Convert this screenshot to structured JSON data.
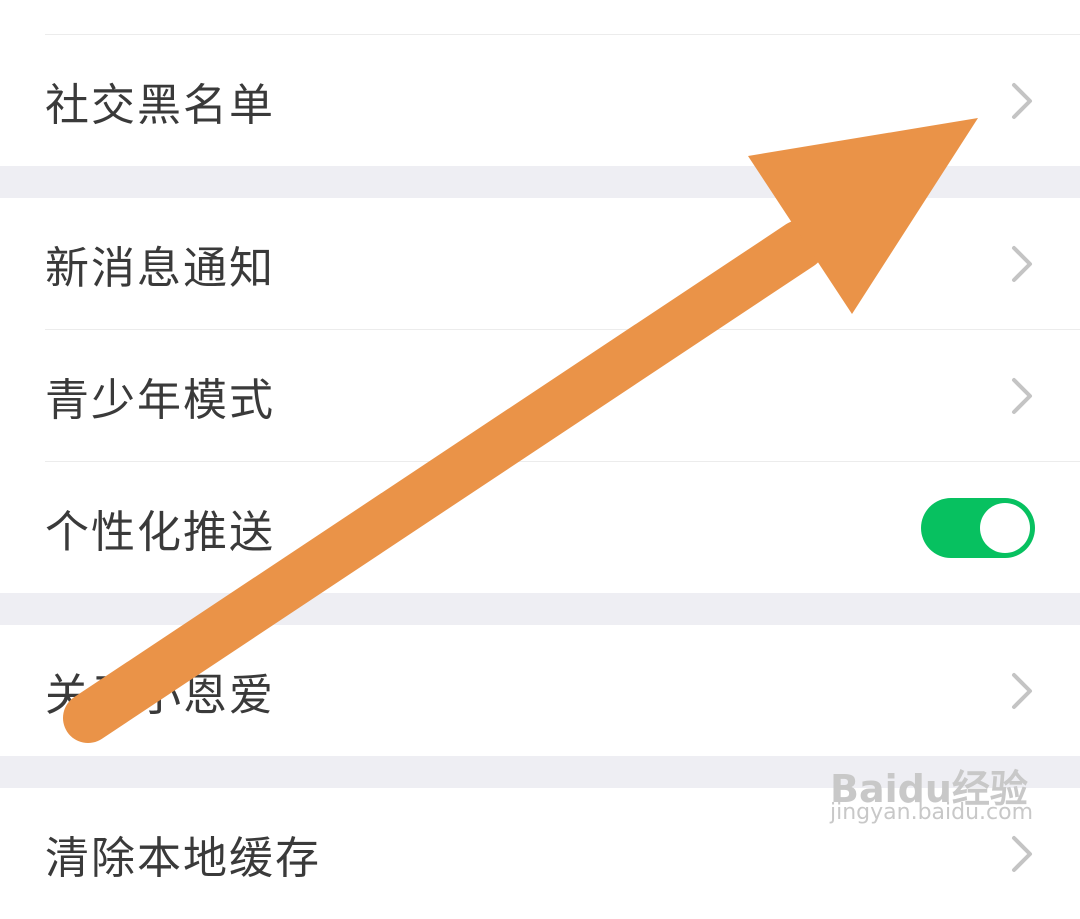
{
  "settings": {
    "items": [
      {
        "label": "社交黑名单",
        "control": "chevron-right-icon"
      },
      {
        "label": "新消息通知",
        "control": "chevron-right-icon"
      },
      {
        "label": "青少年模式",
        "control": "chevron-right-icon"
      },
      {
        "label": "个性化推送",
        "control": "toggle",
        "toggle_on": true
      },
      {
        "label": "关于小恩爱",
        "control": "chevron-right-icon"
      },
      {
        "label": "清除本地缓存",
        "control": "chevron-right-icon"
      }
    ]
  },
  "annotation": {
    "icon": "arrow-icon",
    "color": "#ea9348"
  },
  "watermark": {
    "brand": "Baidu经验",
    "url": "jingyan.baidu.com"
  },
  "colors": {
    "toggle_on": "#07c160",
    "section_gap": "#eeeef3",
    "chevron": "#c4c4c4",
    "text": "#3a3a3a"
  }
}
